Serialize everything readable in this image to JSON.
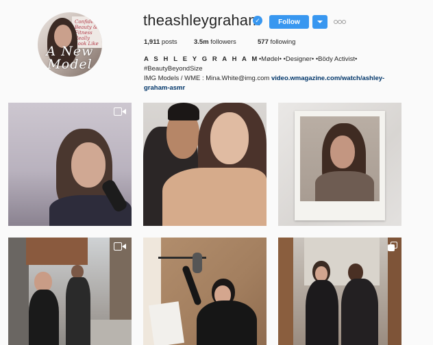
{
  "profile": {
    "username": "theashleygraham",
    "verified": true,
    "follow_label": "Follow",
    "avatar_text": "A New Model",
    "avatar_magazine_text": "Confident Beauty & Fitness Really Look Like",
    "stats": [
      {
        "value": "1,911",
        "label": "posts"
      },
      {
        "value": "3.5m",
        "label": "followers"
      },
      {
        "value": "577",
        "label": "following"
      }
    ],
    "bio": {
      "name": "A S H L E Y G R A H A M",
      "line1_rest": "•Mødel• •Designer• •Bödy Activist• #BeautyBeyondSize",
      "line2_prefix": "IMG Models / WME : Mina.White@img.com ",
      "link": "video.wmagazine.com/watch/ashley-graham-asmr"
    }
  },
  "colors": {
    "accent": "#3897f0",
    "text": "#262626",
    "link": "#003569",
    "background": "#fafafa"
  },
  "icons": {
    "verified": "verified-badge-icon",
    "more": "more-options-icon",
    "video": "video-camera-icon",
    "carousel": "multiple-images-icon"
  },
  "grid": [
    {
      "type": "video"
    },
    {
      "type": "photo"
    },
    {
      "type": "photo"
    },
    {
      "type": "video"
    },
    {
      "type": "photo"
    },
    {
      "type": "carousel"
    }
  ]
}
